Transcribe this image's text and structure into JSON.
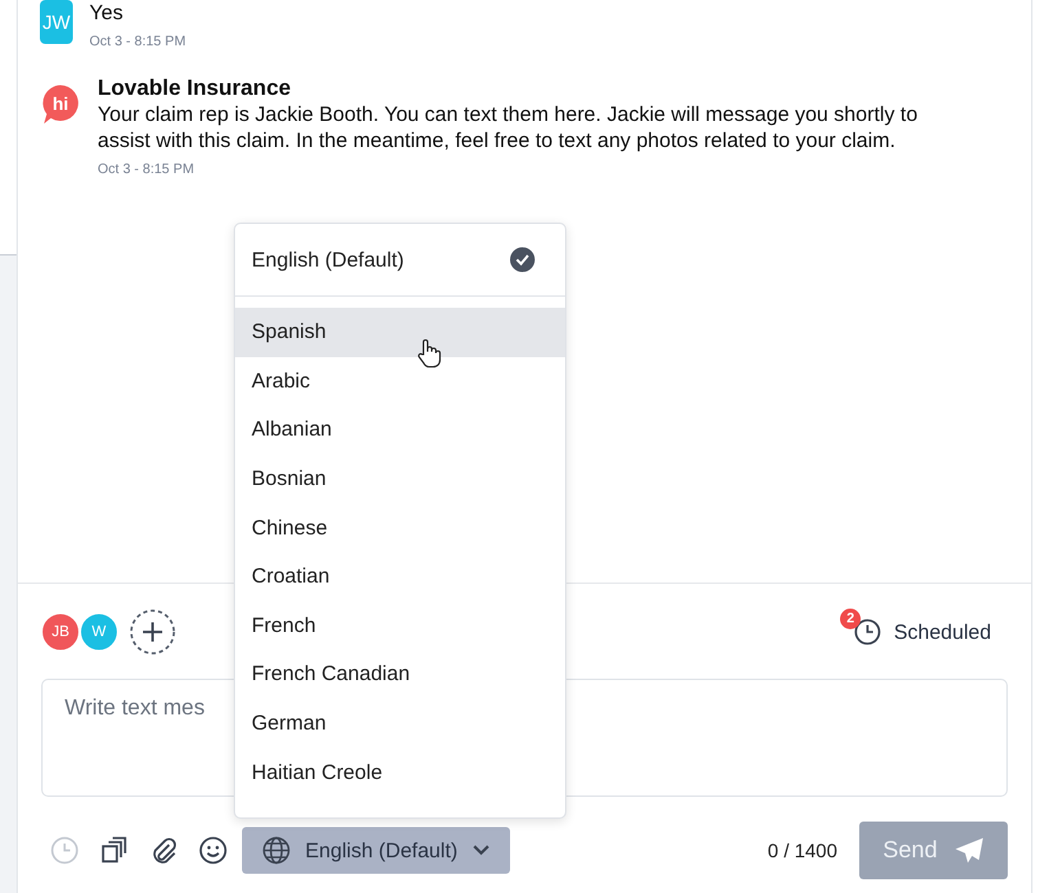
{
  "messages": [
    {
      "avatar": {
        "kind": "initials",
        "text": "JW",
        "color": "#1bbfe3"
      },
      "body": "Yes",
      "time": "Oct 3 - 8:15 PM"
    },
    {
      "avatar": {
        "kind": "bubble",
        "text": "hi",
        "color": "#f25a5a"
      },
      "sender": "Lovable Insurance",
      "body": "Your claim rep is Jackie Booth. You can text them here. Jackie will message you shortly to assist with this claim. In the meantime, feel free to text any photos related to your claim.",
      "time": "Oct 3 - 8:15 PM"
    }
  ],
  "language_menu": {
    "default": {
      "label": "English (Default)",
      "selected": true
    },
    "items": [
      {
        "label": "Spanish",
        "hovered": true
      },
      {
        "label": "Arabic",
        "hovered": false
      },
      {
        "label": "Albanian",
        "hovered": false
      },
      {
        "label": "Bosnian",
        "hovered": false
      },
      {
        "label": "Chinese",
        "hovered": false
      },
      {
        "label": "Croatian",
        "hovered": false
      },
      {
        "label": "French",
        "hovered": false
      },
      {
        "label": "French Canadian",
        "hovered": false
      },
      {
        "label": "German",
        "hovered": false
      },
      {
        "label": "Haitian Creole",
        "hovered": false
      }
    ]
  },
  "participants": [
    {
      "initials": "JB",
      "color": "#f0565a"
    },
    {
      "initials": "W",
      "color": "#1bbfe3"
    }
  ],
  "scheduled": {
    "label": "Scheduled",
    "count": "2"
  },
  "composer": {
    "placeholder": "Write text mes"
  },
  "toolbar": {
    "language": "English (Default)",
    "counter": "0 / 1400",
    "send": {
      "label": "Send",
      "disabled": true
    }
  }
}
